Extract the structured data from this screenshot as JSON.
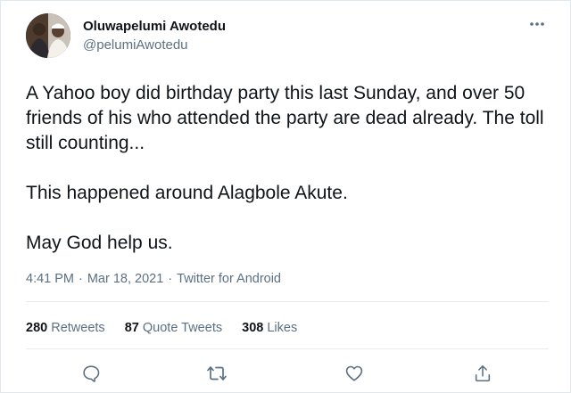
{
  "tweet": {
    "author": {
      "name": "Oluwapelumi Awotedu",
      "handle": "@pelumiAwotedu"
    },
    "paragraphs": [
      "A Yahoo boy did birthday party this last Sunday, and over 50 friends of his who attended the party are dead already. The toll still counting...",
      "This happened around Alagbole Akute.",
      "May God help us."
    ],
    "time": "4:41 PM",
    "separator": "·",
    "date": "Mar 18, 2021",
    "source": "Twitter for Android",
    "stats": {
      "retweets": {
        "count": "280",
        "label": "Retweets"
      },
      "quote_tweets": {
        "count": "87",
        "label": "Quote Tweets"
      },
      "likes": {
        "count": "308",
        "label": "Likes"
      }
    }
  },
  "icons": {
    "more": "more-dots-icon",
    "reply": "reply-icon",
    "retweet": "retweet-icon",
    "like": "heart-icon",
    "share": "share-icon"
  },
  "colors": {
    "text": "#0f1419",
    "secondary": "#5b7083",
    "divider": "#e6ecf0"
  }
}
